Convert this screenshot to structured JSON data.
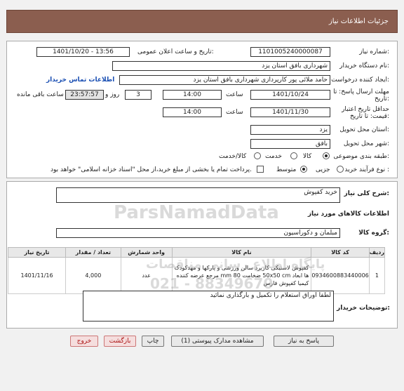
{
  "header": {
    "title": "جزئیات اطلاعات نیاز"
  },
  "fields": {
    "need_number_label": "شماره نیاز:",
    "need_number": "1101005240000087",
    "announce_label": "تاریخ و ساعت اعلان عمومی:",
    "announce_value": "1401/10/20 - 13:56",
    "buyer_org_label": "نام دستگاه خریدار:",
    "buyer_org": "شهرداری بافق استان یزد",
    "requester_label": "ایجاد کننده درخواست:",
    "requester": "حامد ملائی پور کارپردازی شهرداری بافق استان یزد",
    "contact_link": "اطلاعات تماس خریدار",
    "deadline_label": "مهلت ارسال پاسخ: تا تاریخ:",
    "deadline_date": "1401/10/24",
    "time_label": "ساعت",
    "deadline_time": "14:00",
    "days_value": "3",
    "days_label": "روز و",
    "remaining_time": "23:57:57",
    "remaining_label": "ساعت باقی مانده",
    "validity_label": "حداقل تاریخ اعتبار قیمت: تا تاریخ:",
    "validity_date": "1401/11/30",
    "validity_time": "14:00",
    "province_label": "استان محل تحویل:",
    "province": "یزد",
    "city_label": "شهر محل تحویل:",
    "city": "بافق",
    "category_label": "طبقه بندی موضوعی:",
    "category_options": [
      "کالا",
      "خدمت",
      "کالا/خدمت"
    ],
    "process_label": "نوع فرآیند خرید :",
    "process_options": [
      "جزیی",
      "متوسط"
    ],
    "treasury_note": "پرداخت تمام یا بخشی از مبلغ خرید،از محل \"اسناد خزانه اسلامی\" خواهد بود."
  },
  "summary": {
    "label": "شرح کلی نیاز:",
    "value": "خرید کفپوش"
  },
  "goods": {
    "section_title": "اطلاعات کالاهای مورد نیاز",
    "group_label": "گروه کالا:",
    "group_value": "مبلمان و دکوراسیون",
    "columns": [
      "ردیف",
      "کد کالا",
      "نام کالا",
      "واحد شمارش",
      "تعداد / مقدار",
      "تاریخ نیاز"
    ],
    "rows": [
      {
        "index": "1",
        "code": "0934600883440006",
        "name": "کفپوش لاستیکی کاربرد سالن ورزشی و پارکها و مهدکودک ها ابعاد 50x50 cm ضخامت 80 mm مرجع عرضه کننده کیمیا کفپوش فارس",
        "unit": "عدد",
        "qty": "4,000",
        "date": "1401/11/16"
      }
    ]
  },
  "buyer_notes": {
    "label": "توضیحات خریدار:",
    "value": "لطفا اوراق استعلام را تکمیل و بارگذاری نمائید"
  },
  "buttons": {
    "reply": "پاسخ به نیاز",
    "docs": "مشاهده مدارک پیوستی (1)",
    "print": "چاپ",
    "back": "بازگشت",
    "exit": "خروج"
  },
  "watermark": {
    "brand": "ParsNamadData",
    "line1": "پایگاه اطلاع رسانی مناقصات",
    "phone": "021 - 88349670"
  }
}
